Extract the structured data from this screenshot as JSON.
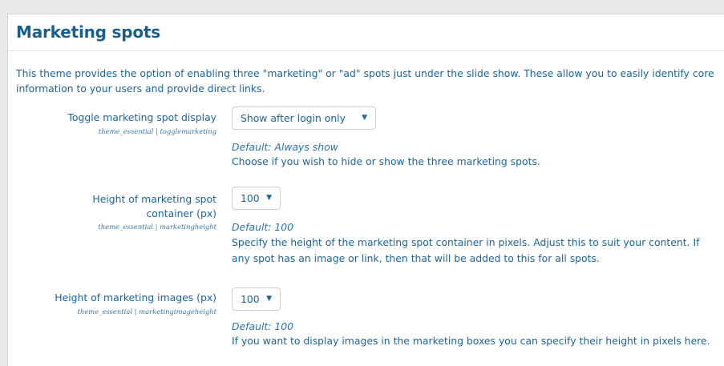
{
  "section": {
    "title": "Marketing spots",
    "intro": "This theme provides the option of enabling three \"marketing\" or \"ad\" spots just under the slide show. These allow you to easily identify core information to your users and provide direct links."
  },
  "settings": [
    {
      "label": "Toggle marketing spot display",
      "key": "theme_essential | togglemarketing",
      "value": "Show after login only",
      "default": "Default: Always show",
      "description": "Choose if you wish to hide or show the three marketing spots."
    },
    {
      "label": "Height of marketing spot container (px)",
      "key": "theme_essential | marketingheight",
      "value": "100",
      "default": "Default: 100",
      "description": "Specify the height of the marketing spot container in pixels. Adjust this to suit your content. If any spot has an image or link, then that will be added to this for all spots."
    },
    {
      "label": "Height of marketing images (px)",
      "key": "theme_essential | marketingimageheight",
      "value": "100",
      "default": "Default: 100",
      "description": "If you want to display images in the marketing boxes you can specify their height in pixels here."
    }
  ],
  "icons": {
    "dropdown": "caret-down-icon"
  }
}
